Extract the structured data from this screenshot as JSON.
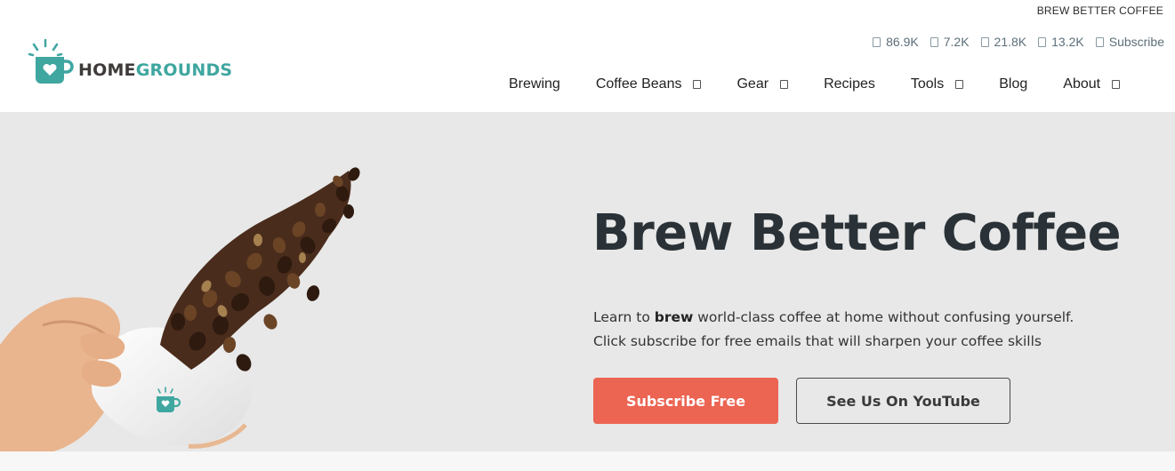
{
  "header": {
    "tagline": "BREW BETTER COFFEE",
    "logo": {
      "home": "HOME",
      "grounds": "GROUNDS"
    },
    "social": [
      {
        "icon": "facebook-icon",
        "count": "86.9K"
      },
      {
        "icon": "instagram-icon",
        "count": "7.2K"
      },
      {
        "icon": "pinterest-icon",
        "count": "21.8K"
      },
      {
        "icon": "youtube-icon",
        "count": "13.2K"
      },
      {
        "icon": "email-icon",
        "count": "Subscribe"
      }
    ],
    "nav": [
      {
        "label": "Brewing",
        "has_dropdown": false
      },
      {
        "label": "Coffee Beans",
        "has_dropdown": true
      },
      {
        "label": "Gear",
        "has_dropdown": true
      },
      {
        "label": "Recipes",
        "has_dropdown": false
      },
      {
        "label": "Tools",
        "has_dropdown": true
      },
      {
        "label": "Blog",
        "has_dropdown": false
      },
      {
        "label": "About",
        "has_dropdown": true
      }
    ]
  },
  "hero": {
    "title": "Brew Better Coffee",
    "desc_line1_pre": "Learn to ",
    "desc_line1_bold": "brew",
    "desc_line1_post": " world-class coffee at home without confusing yourself.",
    "desc_line2": "Click subscribe for free emails that will sharpen your coffee skills",
    "primary_button": "Subscribe Free",
    "secondary_button": "See Us On YouTube"
  },
  "colors": {
    "brand_teal": "#3fa6a0",
    "cta_coral": "#ec6452",
    "hero_bg": "#e8e8e8",
    "title_dark": "#2a3237"
  }
}
